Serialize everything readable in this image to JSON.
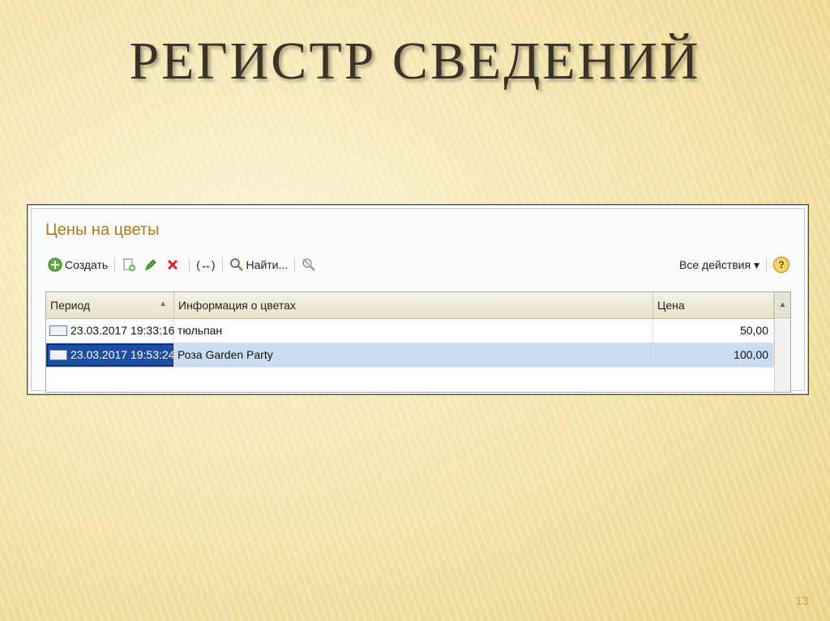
{
  "slide": {
    "title": "РЕГИСТР СВЕДЕНИЙ",
    "page_number": "13"
  },
  "window": {
    "title": "Цены на цветы",
    "toolbar": {
      "create_label": "Создать",
      "find_label": "Найти...",
      "period_label": "(↔)",
      "all_actions_label": "Все действия ▾",
      "help_label": "?"
    },
    "table": {
      "columns": [
        "Период",
        "Информация о цветах",
        "Цена"
      ],
      "rows": [
        {
          "period": "23.03.2017 19:33:16",
          "info": "тюльпан",
          "price": "50,00",
          "selected": false
        },
        {
          "period": "23.03.2017 19:53:24",
          "info": "Роза Garden Party",
          "price": "100,00",
          "selected": true
        }
      ]
    }
  }
}
